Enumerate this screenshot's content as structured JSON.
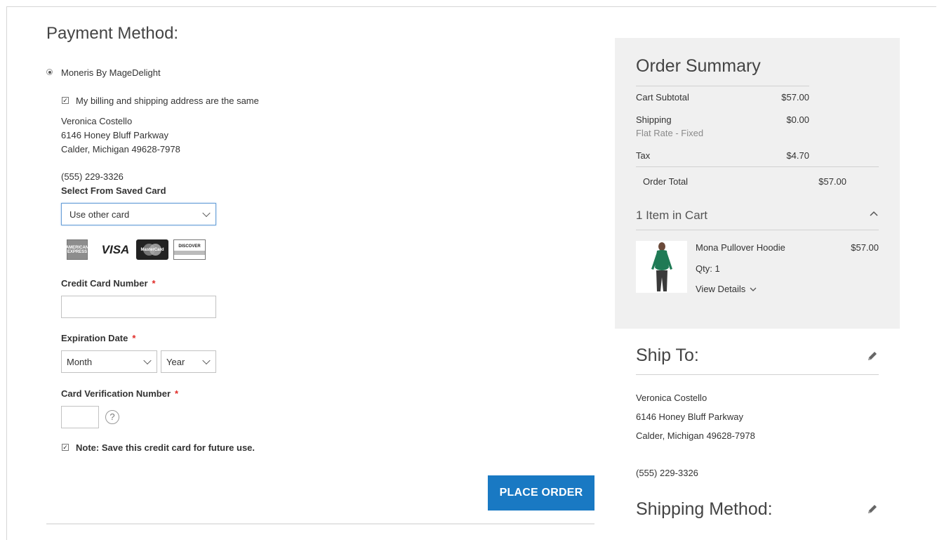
{
  "payment": {
    "title": "Payment Method:",
    "method_label": "Moneris By MageDelight",
    "same_address_label": "My billing and shipping address are the same",
    "billing_address": {
      "name": "Veronica Costello",
      "street": "6146 Honey Bluff Parkway",
      "city_line": "Calder, Michigan 49628-7978",
      "phone": "(555) 229-3326"
    },
    "saved_card_label": "Select From Saved Card",
    "saved_card_value": "Use other card",
    "card_icons": [
      "amex-icon",
      "visa-icon",
      "mastercard-icon",
      "discover-icon"
    ],
    "card_text": {
      "amex": "AMERICAN EXPRESS",
      "visa": "VISA",
      "mastercard": "MasterCard",
      "discover": "DISCOVER"
    },
    "cc_number_label": "Credit Card Number",
    "cc_number_value": "",
    "required_mark": "*",
    "expiration_label": "Expiration Date",
    "month_value": "Month",
    "year_value": "Year",
    "cvv_label": "Card Verification Number",
    "cvv_value": "",
    "help_glyph": "?",
    "save_note_strong": "Note:",
    "save_note_text": "Save this credit card for future use.",
    "place_order_label": "PLACE ORDER",
    "same_address_checked": true,
    "save_card_checked": true
  },
  "summary": {
    "title": "Order Summary",
    "rows": [
      {
        "label": "Cart Subtotal",
        "value": "$57.00"
      },
      {
        "label": "Shipping",
        "sub": "Flat Rate - Fixed",
        "value": "$0.00"
      },
      {
        "label": "Tax",
        "value": "$4.70"
      }
    ],
    "total_label": "Order Total",
    "total_value": "$57.00",
    "items_in_cart": "1 Item in Cart",
    "item": {
      "name": "Mona Pullover Hoodie",
      "price": "$57.00",
      "qty": "Qty: 1",
      "details_link": "View Details"
    }
  },
  "ship_to": {
    "title": "Ship To:",
    "name": "Veronica Costello",
    "street": "6146 Honey Bluff Parkway",
    "city_line": "Calder, Michigan 49628-7978",
    "phone": "(555) 229-3326"
  },
  "shipping_method": {
    "title": "Shipping Method:"
  },
  "colors": {
    "accent": "#1979c3",
    "required": "#e02b27",
    "summary_bg": "#f0f0f0",
    "product": "#1f7a55"
  }
}
